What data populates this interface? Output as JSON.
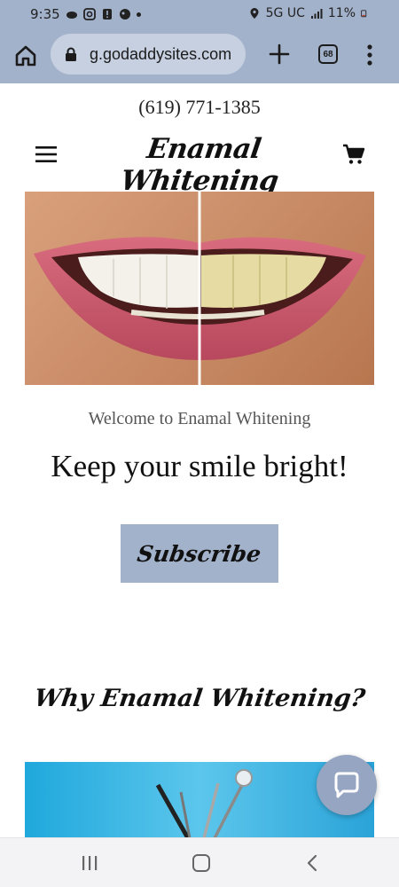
{
  "status_bar": {
    "time": "9:35",
    "network": "5G UC",
    "battery": "11%"
  },
  "browser": {
    "url": "g.godaddysites.com",
    "tab_count": "68"
  },
  "site": {
    "phone": "(619) 771-1385",
    "brand": "Enamal Whitening",
    "welcome": "Welcome to Enamal Whitening",
    "headline": "Keep your smile bright!",
    "subscribe_label": "Subscribe",
    "section_title": "Why Enamal Whitening?"
  },
  "icons": {
    "home": "home-icon",
    "lock": "lock-icon",
    "new_tab": "plus-icon",
    "tabs": "tabs-icon",
    "menu": "more-vert-icon",
    "hamburger": "hamburger-icon",
    "cart": "cart-icon",
    "chat": "chat-icon"
  },
  "colors": {
    "chrome": "#a3b2cb",
    "url_pill": "#c6d0e1",
    "accent": "#a3b2cb"
  }
}
